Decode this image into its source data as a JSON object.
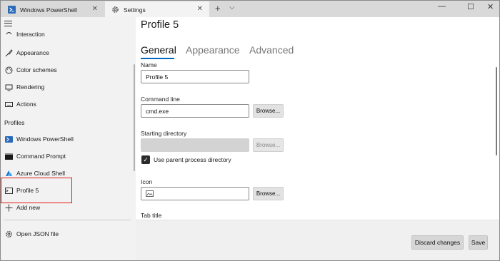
{
  "titlebar": {
    "tabs": [
      {
        "label": "Windows PowerShell",
        "icon": "powershell-icon"
      },
      {
        "label": "Settings",
        "icon": "gear-icon"
      }
    ],
    "new_tab_glyph": "+",
    "dropdown_glyph": "⌵",
    "close_glyph": "✕",
    "minimize_glyph": "—",
    "maximize_glyph": "☐"
  },
  "sidebar": {
    "top_items": [
      {
        "label": "Interaction",
        "icon": "interaction-icon"
      },
      {
        "label": "Appearance",
        "icon": "paint-brush-icon"
      },
      {
        "label": "Color schemes",
        "icon": "palette-icon"
      },
      {
        "label": "Rendering",
        "icon": "monitor-icon"
      },
      {
        "label": "Actions",
        "icon": "keyboard-icon"
      }
    ],
    "profiles_heading": "Profiles",
    "profiles": [
      {
        "label": "Windows PowerShell",
        "icon": "powershell-icon"
      },
      {
        "label": "Command Prompt",
        "icon": "command-prompt-icon"
      },
      {
        "label": "Azure Cloud Shell",
        "icon": "azure-icon"
      },
      {
        "label": "Profile 5",
        "icon": "terminal-icon"
      }
    ],
    "add_new": {
      "label": "Add new",
      "icon": "plus-icon"
    },
    "open_json": {
      "label": "Open JSON file",
      "icon": "gear-icon"
    }
  },
  "main": {
    "title": "Profile 5",
    "tabs": [
      {
        "label": "General",
        "selected": true
      },
      {
        "label": "Appearance",
        "selected": false
      },
      {
        "label": "Advanced",
        "selected": false
      }
    ],
    "name": {
      "label": "Name",
      "value": "Profile 5"
    },
    "command_line": {
      "label": "Command line",
      "value": "cmd.exe",
      "browse": "Browse..."
    },
    "starting_directory": {
      "label": "Starting directory",
      "value": "",
      "browse": "Browse...",
      "checkbox_label": "Use parent process directory",
      "checked": true
    },
    "icon": {
      "label": "Icon",
      "value": "",
      "browse": "Browse..."
    },
    "tab_title": {
      "label": "Tab title"
    },
    "footer": {
      "discard": "Discard changes",
      "save": "Save"
    }
  },
  "colors": {
    "accent": "#0067c0",
    "highlight": "#e01a1a"
  }
}
